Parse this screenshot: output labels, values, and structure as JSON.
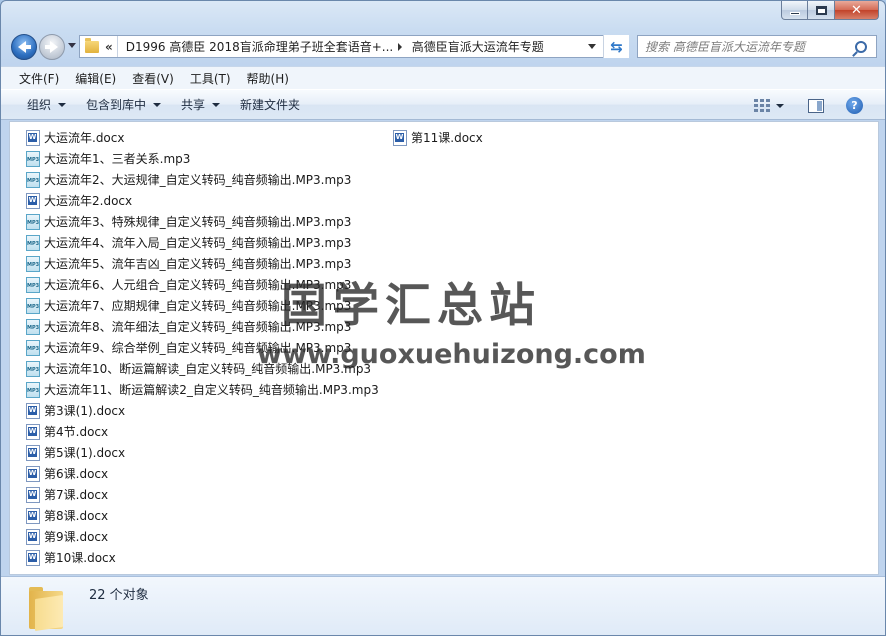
{
  "window": {
    "close_glyph": "✕"
  },
  "nav": {
    "address_overflow": "«",
    "crumbs": [
      "D1996 高德臣 2018盲派命理弟子班全套语音+...",
      "高德臣盲派大运流年专题"
    ],
    "search_placeholder": "搜索 高德臣盲派大运流年专题"
  },
  "menubar": {
    "items": [
      "文件(F)",
      "编辑(E)",
      "查看(V)",
      "工具(T)",
      "帮助(H)"
    ]
  },
  "commandbar": {
    "organize": "组织",
    "include_library": "包含到库中",
    "share": "共享",
    "new_folder": "新建文件夹",
    "help": "?"
  },
  "files": {
    "column1": [
      {
        "name": "大运流年.docx",
        "type": "docx"
      },
      {
        "name": "大运流年1、三者关系.mp3",
        "type": "mp3"
      },
      {
        "name": "大运流年2、大运规律_自定义转码_纯音频输出.MP3.mp3",
        "type": "mp3"
      },
      {
        "name": "大运流年2.docx",
        "type": "docx"
      },
      {
        "name": "大运流年3、特殊规律_自定义转码_纯音频输出.MP3.mp3",
        "type": "mp3"
      },
      {
        "name": "大运流年4、流年入局_自定义转码_纯音频输出.MP3.mp3",
        "type": "mp3"
      },
      {
        "name": "大运流年5、流年吉凶_自定义转码_纯音频输出.MP3.mp3",
        "type": "mp3"
      },
      {
        "name": "大运流年6、人元组合_自定义转码_纯音频输出.MP3.mp3",
        "type": "mp3"
      },
      {
        "name": "大运流年7、应期规律_自定义转码_纯音频输出.MP3.mp3",
        "type": "mp3"
      },
      {
        "name": "大运流年8、流年细法_自定义转码_纯音频输出.MP3.mp3",
        "type": "mp3"
      },
      {
        "name": "大运流年9、综合举例_自定义转码_纯音频输出.MP3.mp3",
        "type": "mp3"
      },
      {
        "name": "大运流年10、断运篇解读_自定义转码_纯音频输出.MP3.mp3",
        "type": "mp3"
      },
      {
        "name": "大运流年11、断运篇解读2_自定义转码_纯音频输出.MP3.mp3",
        "type": "mp3"
      },
      {
        "name": "第3课(1).docx",
        "type": "docx"
      },
      {
        "name": "第4节.docx",
        "type": "docx"
      },
      {
        "name": "第5课(1).docx",
        "type": "docx"
      },
      {
        "name": "第6课.docx",
        "type": "docx"
      },
      {
        "name": "第7课.docx",
        "type": "docx"
      },
      {
        "name": "第8课.docx",
        "type": "docx"
      },
      {
        "name": "第9课.docx",
        "type": "docx"
      },
      {
        "name": "第10课.docx",
        "type": "docx"
      }
    ],
    "column2": [
      {
        "name": "第11课.docx",
        "type": "docx"
      }
    ]
  },
  "watermark": {
    "title": "国学汇总站",
    "url": "www.guoxuehuizong.com"
  },
  "details": {
    "count": "22 个对象"
  }
}
